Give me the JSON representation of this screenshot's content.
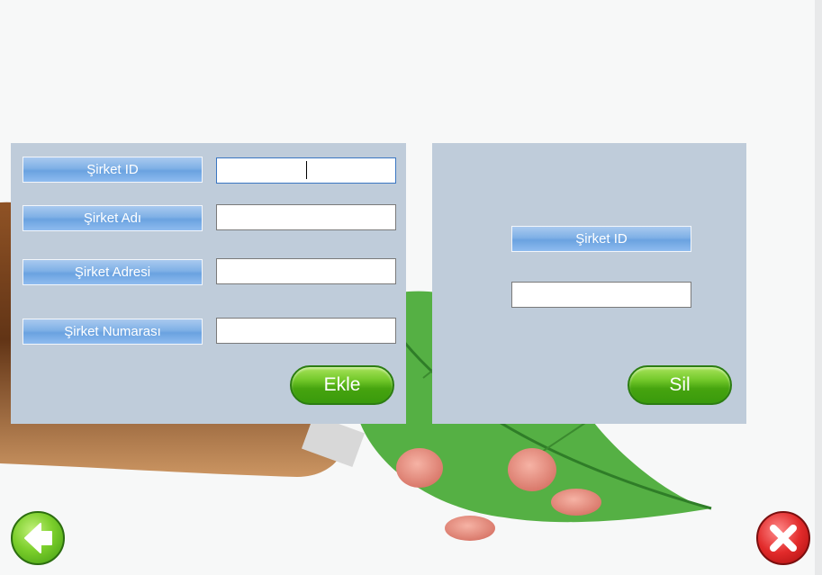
{
  "add_form": {
    "fields": [
      {
        "label": "Şirket ID",
        "value": ""
      },
      {
        "label": "Şirket Adı",
        "value": ""
      },
      {
        "label": "Şirket Adresi",
        "value": ""
      },
      {
        "label": "Şirket Numarası",
        "value": ""
      }
    ],
    "submit_label": "Ekle"
  },
  "delete_form": {
    "field_label": "Şirket ID",
    "field_value": "",
    "submit_label": "Sil"
  },
  "nav": {
    "back_icon": "back-arrow-icon",
    "close_icon": "close-x-icon"
  },
  "colors": {
    "panel": "#bfccda",
    "label_gradient_mid": "#7fb0e6",
    "button_green": "#46a40f",
    "close_red": "#e22b2b"
  }
}
